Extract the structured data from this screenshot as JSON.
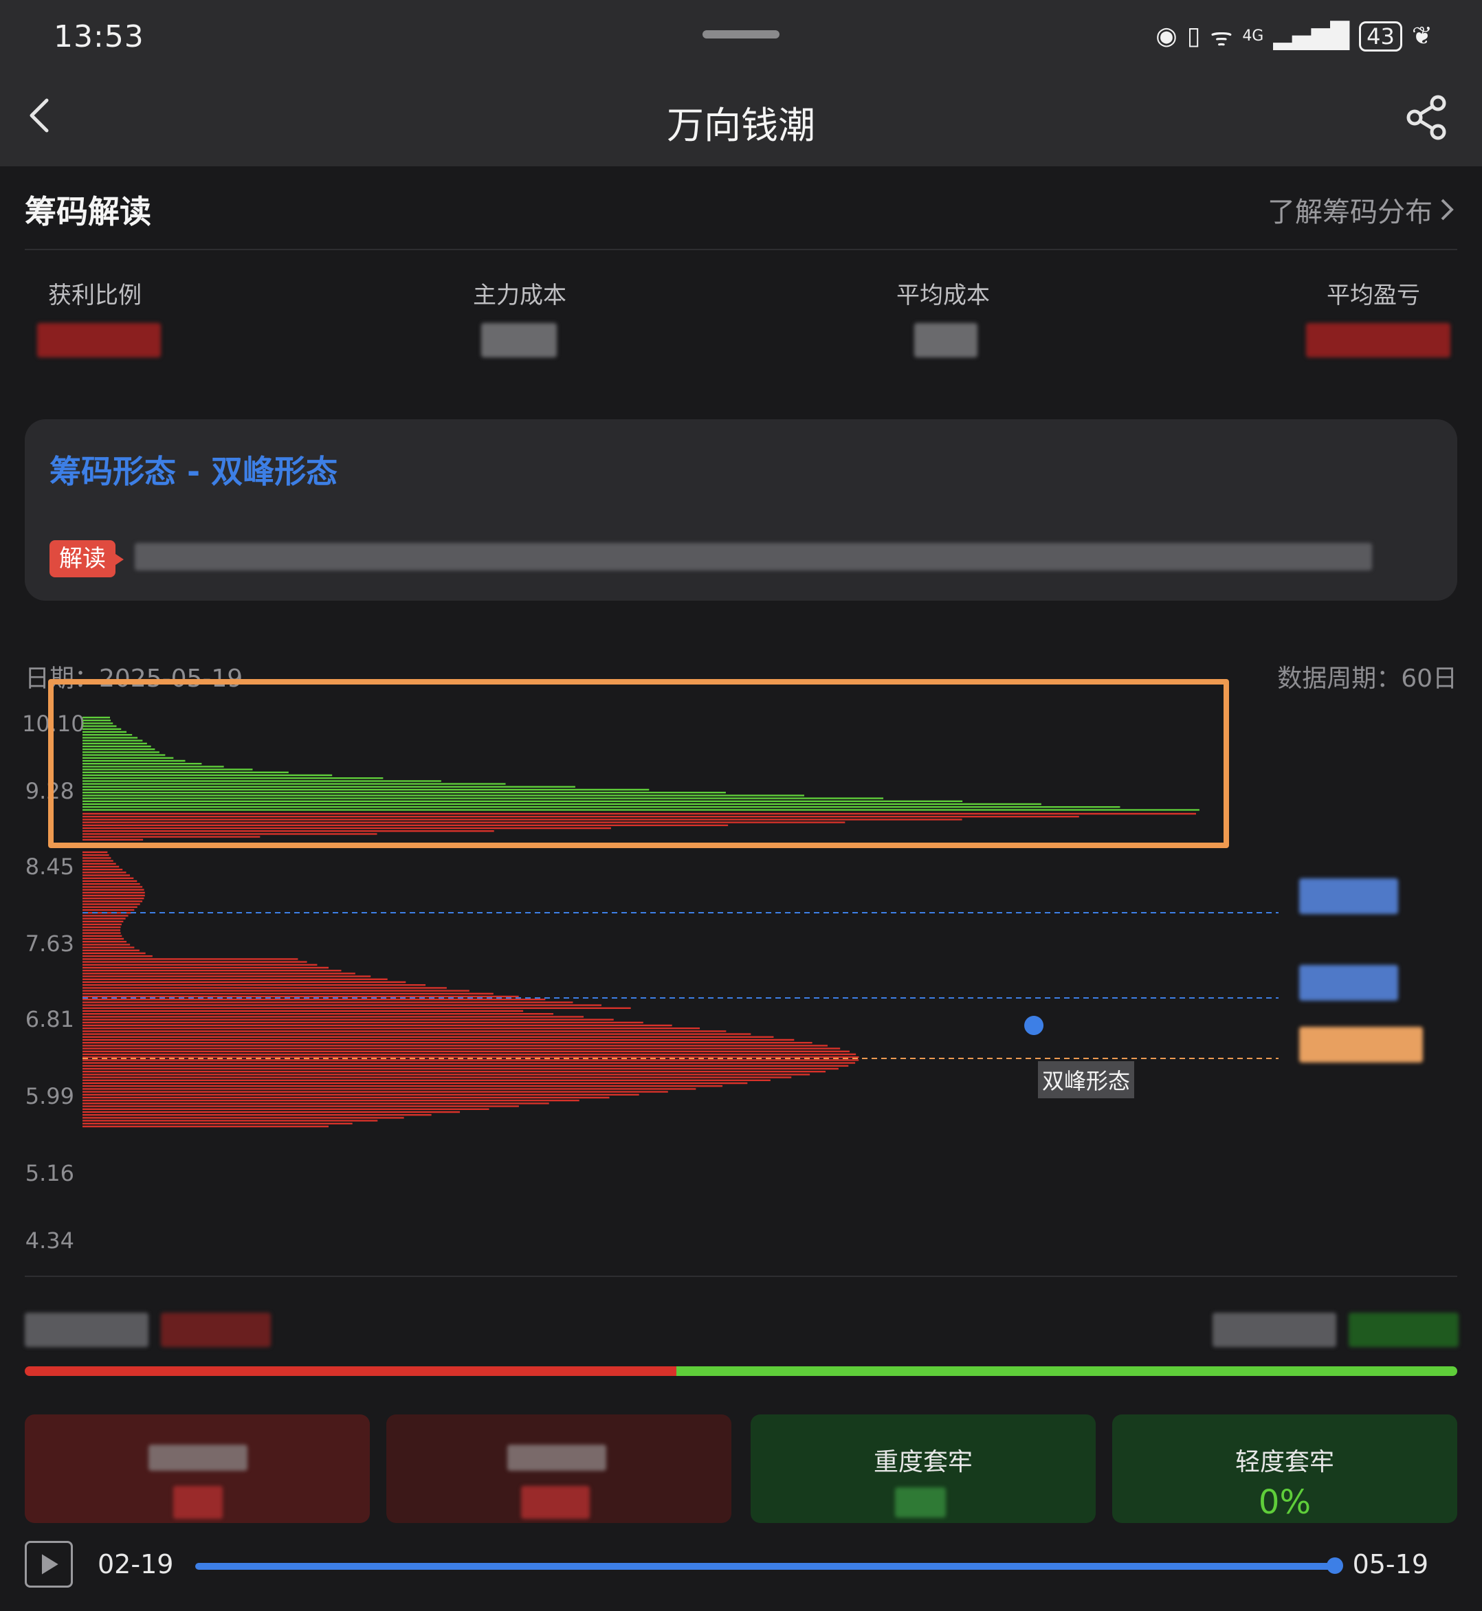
{
  "status_bar": {
    "time": "13:53",
    "battery": "43",
    "network": "4G"
  },
  "header": {
    "title": "万向钱潮"
  },
  "section": {
    "title": "筹码解读",
    "learn_link": "了解筹码分布"
  },
  "stats": {
    "profit_ratio_label": "获利比例",
    "main_cost_label": "主力成本",
    "avg_cost_label": "平均成本",
    "avg_profit_label": "平均盈亏"
  },
  "pattern_card": {
    "title": "筹码形态 - 双峰形态",
    "tag": "解读"
  },
  "chart_header": {
    "date": "日期：2025-05-19",
    "period": "数据周期：60日"
  },
  "chart_data": {
    "type": "bar",
    "orientation": "horizontal",
    "y_ticks": [
      "10.10",
      "9.28",
      "8.45",
      "7.63",
      "6.81",
      "5.99",
      "5.16",
      "4.34"
    ],
    "annotation": "双峰形态",
    "colors": {
      "profit": "#5fce3a",
      "loss": "#d8322a",
      "highlight": "#ef9a50",
      "ref_line": "#3d7fe6"
    }
  },
  "split_bar": {
    "loss_fraction": 0.455,
    "profit_fraction": 0.545,
    "loss_color": "#d8322a",
    "profit_color": "#5fce3a"
  },
  "cells": [
    {
      "title": "",
      "value": ""
    },
    {
      "title": "",
      "value": ""
    },
    {
      "title": "重度套牢",
      "value": ""
    },
    {
      "title": "轻度套牢",
      "value": "0%"
    }
  ],
  "timeline": {
    "start": "02-19",
    "end": "05-19",
    "progress": 1.0
  }
}
